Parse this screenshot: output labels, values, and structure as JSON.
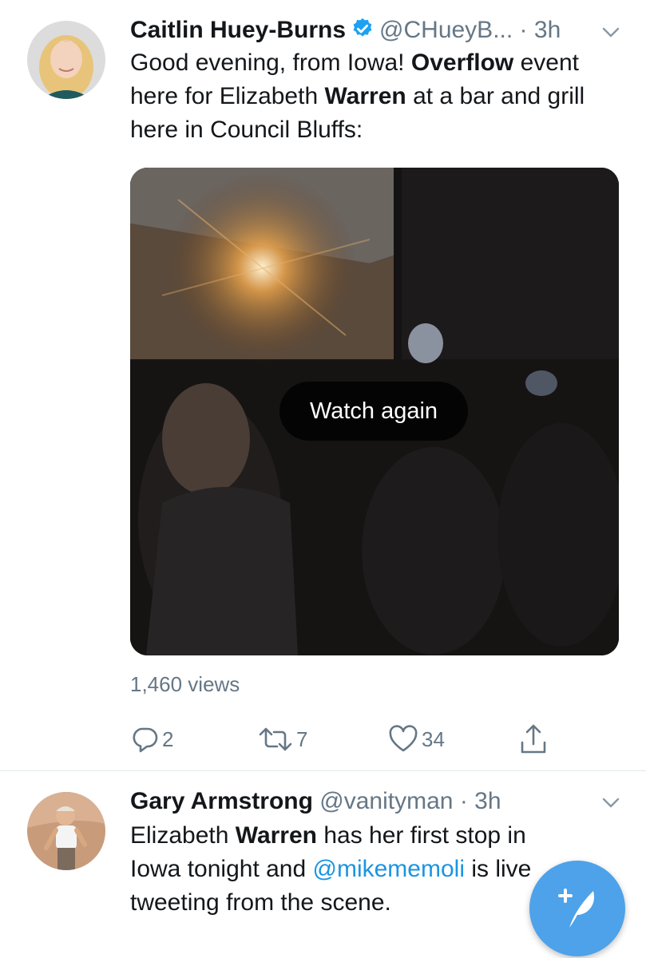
{
  "tweets": [
    {
      "name": "Caitlin Huey-Burns",
      "handle": "@CHueyB...",
      "separator": "·",
      "time": "3h",
      "verified": true,
      "text": {
        "p1": "Good evening, from Iowa! ",
        "b1": "Overflow",
        "p2": " event here for Elizabeth ",
        "b2": "Warren",
        "p3": " at a bar and grill here in Council Bluffs:"
      },
      "video": {
        "overlay_label": "Watch again"
      },
      "views": "1,460 views",
      "actions": {
        "replies": "2",
        "retweets": "7",
        "likes": "34"
      }
    },
    {
      "name": "Gary Armstrong",
      "handle": "@vanityman",
      "separator": "·",
      "time": "3h",
      "verified": false,
      "text": {
        "p1": "Elizabeth ",
        "b1": "Warren",
        "p2": " has her first stop in Iowa tonight and ",
        "mention": "@mikememoli",
        "p3": " is live tweeting from the scene."
      }
    }
  ],
  "icons": {
    "verified": "verified-badge-icon",
    "chevron": "chevron-down-icon",
    "reply": "reply-icon",
    "retweet": "retweet-icon",
    "like": "heart-icon",
    "share": "share-icon",
    "compose": "compose-tweet-icon"
  },
  "colors": {
    "link": "#1b95e0",
    "secondary_text": "#657786",
    "fab": "#4da2ea",
    "verified": "#1da1f2"
  }
}
